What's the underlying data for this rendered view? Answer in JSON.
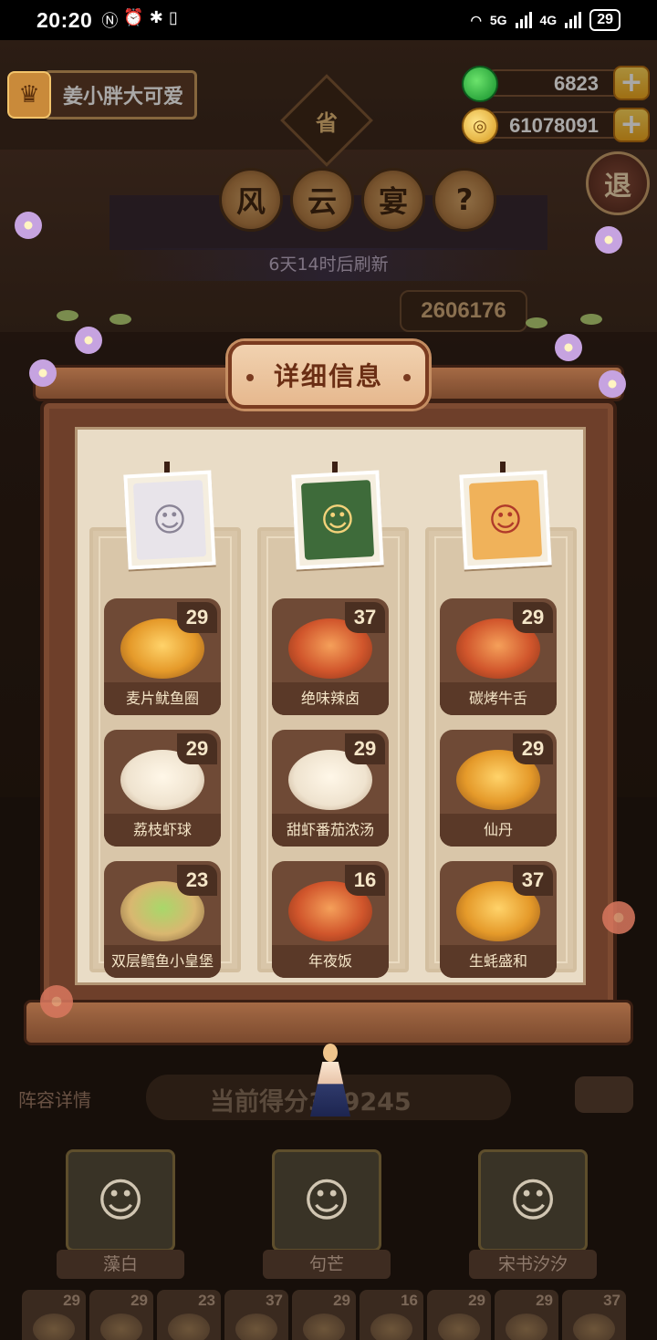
{
  "status_bar": {
    "time": "20:20",
    "network": "5G",
    "network2": "4G",
    "battery": "29"
  },
  "player": {
    "name": "姜小胖大可爱"
  },
  "currency": {
    "jade": "6823",
    "coins": "61078091"
  },
  "header": {
    "top_medal": "省",
    "title_chars": [
      "风",
      "云",
      "宴"
    ],
    "help": "?",
    "exit": "退",
    "refresh_text": "6天14时后刷新",
    "score_tag": "2606176"
  },
  "modal": {
    "title": "详细信息",
    "columns": [
      {
        "dishes": [
          {
            "name": "麦片鱿鱼圈",
            "count": "29",
            "style": "gold"
          },
          {
            "name": "荔枝虾球",
            "count": "29",
            "style": "white"
          },
          {
            "name": "双层鳕鱼小皇堡",
            "count": "23",
            "style": "green"
          }
        ]
      },
      {
        "dishes": [
          {
            "name": "绝味辣卤",
            "count": "37",
            "style": "red"
          },
          {
            "name": "甜虾番茄浓汤",
            "count": "29",
            "style": "white"
          },
          {
            "name": "年夜饭",
            "count": "16",
            "style": "red"
          }
        ]
      },
      {
        "dishes": [
          {
            "name": "碳烤牛舌",
            "count": "29",
            "style": "red"
          },
          {
            "name": "仙丹",
            "count": "29",
            "style": "gold"
          },
          {
            "name": "生蚝盛和",
            "count": "37",
            "style": "gold"
          }
        ]
      }
    ]
  },
  "bottom": {
    "lineup_label": "阵容详情",
    "current_score": "当前得分369245",
    "heroes": [
      "藻白",
      "句芒",
      "宋书汐汐"
    ],
    "mini_counts": [
      "29",
      "29",
      "23",
      "37",
      "29",
      "16",
      "29",
      "29",
      "37"
    ]
  },
  "colors": {
    "board_wood": "#6e3f2a",
    "paper": "#e9dcc6",
    "dish_tile": "#6f4a36",
    "title_text": "#6b2e14"
  }
}
